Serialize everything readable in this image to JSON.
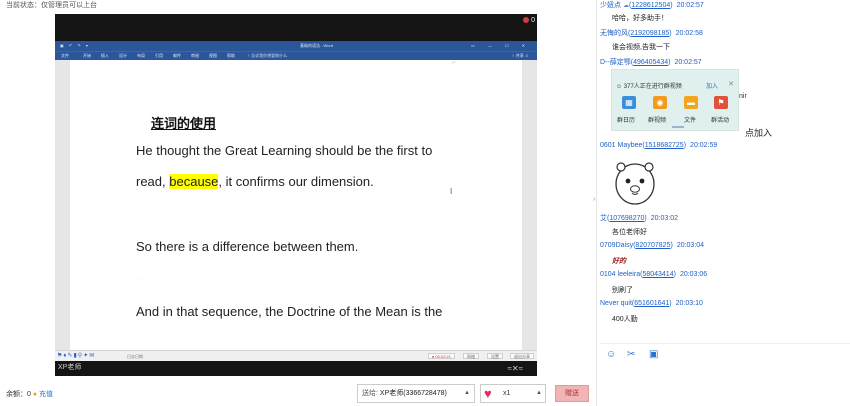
{
  "status_text": "当前状态：仅管理员可以上台",
  "video": {
    "rec_count": "0",
    "caption": "XP老师",
    "control_symbol": "≈✕≈"
  },
  "word": {
    "title": "基础的语法 - Word",
    "menu": [
      "文件",
      "开始",
      "插入",
      "设计",
      "布局",
      "引用",
      "邮件",
      "审阅",
      "视图",
      "帮助"
    ],
    "tell_me": "♀ 告诉我你想要做什么",
    "right_tools": "♀ 共享 ☺",
    "heading": "连词的使用",
    "line1": "He thought the Great Learning should be the first to",
    "line2_pre": "read, ",
    "line2_highlight": "because",
    "line2_post": ", it confirms our dimension.",
    "line3": "So there is a difference between them.",
    "line4": "And in that sequence, the Doctrine of the Mean is the",
    "taskbar_label": "日志日期",
    "status_chips": [
      "● 00:02:21",
      "网络",
      "设置",
      "退出分享"
    ]
  },
  "bottom": {
    "balance_label": "余额：0",
    "recharge": "充值",
    "recipient_label": "送给:",
    "recipient_value": "XP老师(3366728478)",
    "gift_qty": "x1",
    "send": "赠送"
  },
  "chat": {
    "messages": [
      {
        "name": "少妞点",
        "uid": "1228612504",
        "time": "20:02:57",
        "text": "哈哈，好多助手！"
      },
      {
        "name": "无悔的风",
        "uid": "2192098185",
        "time": "20:02:58",
        "text": "谁会视频,告我一下"
      },
      {
        "name": "D--薛定鄂",
        "uid": "496405434",
        "time": "20:02:57",
        "text": ""
      },
      {
        "name": "0601 Maybee",
        "uid": "1518682725",
        "time": "20:02:59",
        "text": ""
      },
      {
        "name": "艾",
        "uid": "107698270",
        "time": "20:03:02",
        "text": "各位老师好"
      },
      {
        "name": "0709Daisy",
        "uid": "820707825",
        "time": "20:03:04",
        "text": "好的"
      },
      {
        "name": "0104 leeleira",
        "uid": "58043414",
        "time": "20:03:06",
        "text": "别刷了"
      },
      {
        "name": "Never quit",
        "uid": "651601641",
        "time": "20:03:10",
        "text": "400人勤"
      }
    ],
    "screenshot": {
      "banner": "377人正在进行群视频",
      "join": "加入",
      "items": [
        "群日历",
        "群视频",
        "文件",
        "群活动"
      ]
    },
    "overflow_text": "nir",
    "click_join": "点加入"
  },
  "colors": {
    "word_blue": "#2b579a",
    "highlight": "#ffff00",
    "link_blue": "#2060c8",
    "send_bg": "#f2b4b4"
  },
  "icons": {
    "toolbar": [
      "smiley-icon",
      "scissors-icon",
      "image-icon"
    ]
  }
}
